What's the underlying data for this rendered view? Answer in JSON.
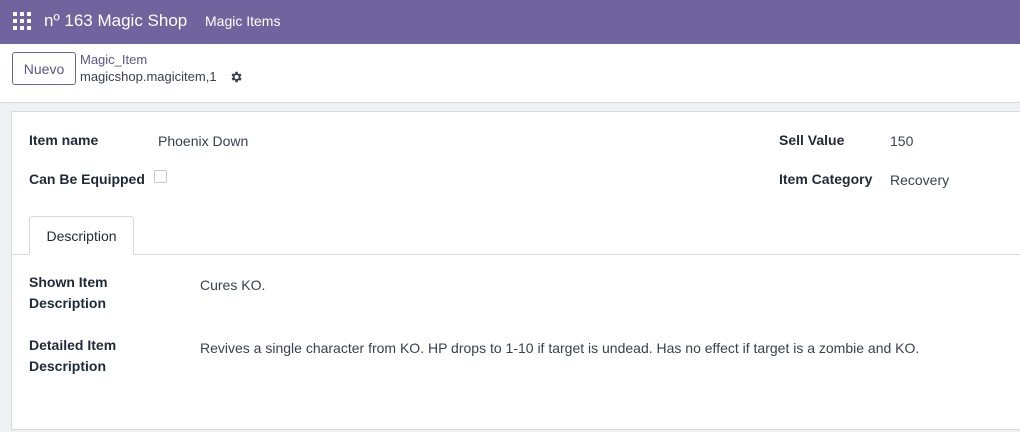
{
  "navbar": {
    "brand": "nº 163 Magic Shop",
    "menu_item": "Magic Items",
    "color": "#71639e"
  },
  "control_panel": {
    "new_button": "Nuevo",
    "breadcrumb": "Magic_Item",
    "record_name": "magicshop.magicitem,1"
  },
  "form": {
    "item_name_label": "Item name",
    "item_name_value": "Phoenix Down",
    "can_be_equipped_label": "Can Be Equipped",
    "can_be_equipped_value": false,
    "sell_value_label": "Sell Value",
    "sell_value_value": "150",
    "item_category_label": "Item Category",
    "item_category_value": "Recovery"
  },
  "tabs": [
    {
      "label": "Description",
      "active": true
    }
  ],
  "description": {
    "shown_label_line1": "Shown Item",
    "shown_label_line2": "Description",
    "shown_value": "Cures KO.",
    "detailed_label_line1": "Detailed Item",
    "detailed_label_line2": "Description",
    "detailed_value": "Revives a single character from KO. HP drops to 1-10 if target is undead. Has no effect if target is a zombie and KO."
  }
}
